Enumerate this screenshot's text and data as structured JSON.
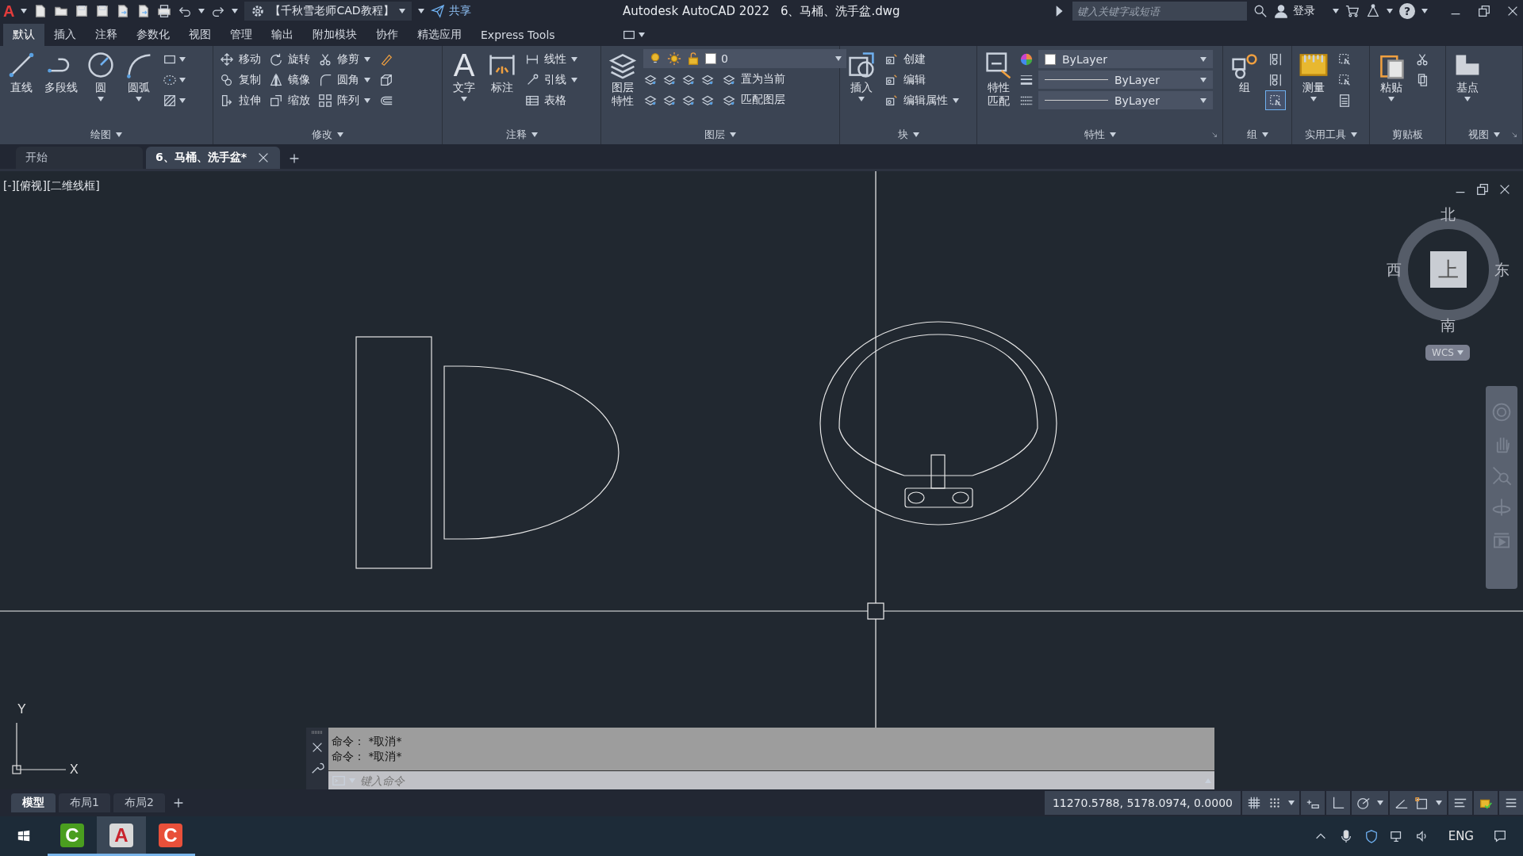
{
  "title_bar": {
    "app_glyph": "A",
    "workspace": "【千秋雪老师CAD教程】",
    "share": "共享",
    "app_title": "Autodesk AutoCAD 2022",
    "file_title": "6、马桶、洗手盆.dwg",
    "search": {
      "placeholder": "键入关键字或短语"
    },
    "user": "登录",
    "help_glyph": "?"
  },
  "ribbon": {
    "tabs": [
      {
        "label": "默认",
        "selected": true
      },
      {
        "label": "插入",
        "selected": false
      },
      {
        "label": "注释",
        "selected": false
      },
      {
        "label": "参数化",
        "selected": false
      },
      {
        "label": "视图",
        "selected": false
      },
      {
        "label": "管理",
        "selected": false
      },
      {
        "label": "输出",
        "selected": false
      },
      {
        "label": "附加模块",
        "selected": false
      },
      {
        "label": "协作",
        "selected": false
      },
      {
        "label": "精选应用",
        "selected": false
      },
      {
        "label": "Express Tools",
        "selected": false
      }
    ],
    "panels": [
      {
        "title": "绘图",
        "menu": true,
        "launcher": false,
        "columns": [
          {
            "kind": "large",
            "label": "直线",
            "dropdown": false
          },
          {
            "kind": "large",
            "label": "多段线",
            "dropdown": false
          },
          {
            "kind": "large",
            "label": "圆",
            "dropdown": true
          },
          {
            "kind": "large",
            "label": "圆弧",
            "dropdown": true
          },
          {
            "kind": "stack",
            "items": [
              {
                "kind": "icon",
                "dropdown": true
              },
              {
                "kind": "icon",
                "dropdown": true
              },
              {
                "kind": "icon",
                "dropdown": true
              }
            ]
          }
        ]
      },
      {
        "title": "修改",
        "menu": true,
        "launcher": false,
        "columns": [
          {
            "kind": "stack",
            "items": [
              {
                "kind": "small",
                "label": "移动",
                "dropdown": false
              },
              {
                "kind": "small",
                "label": "复制",
                "dropdown": false
              },
              {
                "kind": "small",
                "label": "拉伸",
                "dropdown": false
              }
            ]
          },
          {
            "kind": "stack",
            "items": [
              {
                "kind": "small",
                "label": "旋转",
                "dropdown": false
              },
              {
                "kind": "small",
                "label": "镜像",
                "dropdown": false
              },
              {
                "kind": "small",
                "label": "缩放",
                "dropdown": false
              }
            ]
          },
          {
            "kind": "stack",
            "items": [
              {
                "kind": "small",
                "label": "修剪",
                "dropdown": true
              },
              {
                "kind": "small",
                "label": "圆角",
                "dropdown": true
              },
              {
                "kind": "small",
                "label": "阵列",
                "dropdown": true
              }
            ]
          },
          {
            "kind": "stack",
            "items": [
              {
                "kind": "icon",
                "dropdown": false
              },
              {
                "kind": "icon",
                "dropdown": false
              },
              {
                "kind": "icon",
                "dropdown": false
              }
            ]
          }
        ]
      },
      {
        "title": "注释",
        "menu": true,
        "launcher": false,
        "columns": [
          {
            "kind": "large",
            "label": "文字",
            "glyph": "A",
            "dropdown": true
          },
          {
            "kind": "large",
            "label": "标注",
            "dropdown": false
          },
          {
            "kind": "stack",
            "items": [
              {
                "kind": "small",
                "label": "线性",
                "dropdown": true
              },
              {
                "kind": "small",
                "label": "引线",
                "dropdown": true
              },
              {
                "kind": "small",
                "label": "表格",
                "dropdown": false
              }
            ]
          }
        ]
      },
      {
        "title": "图层",
        "menu": true,
        "launcher": false,
        "columns": [
          {
            "kind": "large",
            "label": "图层特性",
            "dropdown": false
          },
          {
            "kind": "stack",
            "items": [
              {
                "kind": "layer_combo",
                "value": "0"
              },
              {
                "kind": "icon_row",
                "label": "置为当前"
              },
              {
                "kind": "icon_row",
                "label": "匹配图层"
              }
            ]
          }
        ]
      },
      {
        "title": "块",
        "menu": true,
        "launcher": false,
        "columns": [
          {
            "kind": "large",
            "label": "插入",
            "dropdown": true
          },
          {
            "kind": "stack",
            "items": [
              {
                "kind": "small",
                "label": "创建",
                "dropdown": false
              },
              {
                "kind": "small",
                "label": "编辑",
                "dropdown": false
              },
              {
                "kind": "small",
                "label": "编辑属性",
                "dropdown": true
              }
            ]
          }
        ]
      },
      {
        "title": "特性",
        "menu": true,
        "launcher": true,
        "columns": [
          {
            "kind": "large",
            "label": "特性匹配",
            "dropdown": false
          },
          {
            "kind": "stack",
            "items": [
              {
                "kind": "color_combo",
                "value": "ByLayer"
              },
              {
                "kind": "lineweight_combo",
                "value": "ByLayer"
              },
              {
                "kind": "linetype_combo",
                "value": "ByLayer"
              }
            ]
          }
        ]
      },
      {
        "title": "组",
        "menu": true,
        "launcher": false,
        "columns": [
          {
            "kind": "large",
            "label": "组",
            "dropdown": false
          },
          {
            "kind": "stack",
            "items": [
              {
                "kind": "icon",
                "dropdown": false,
                "on": false
              },
              {
                "kind": "icon",
                "dropdown": false,
                "on": false
              },
              {
                "kind": "icon",
                "dropdown": false,
                "on": true
              }
            ]
          }
        ]
      },
      {
        "title": "实用工具",
        "menu": true,
        "launcher": false,
        "columns": [
          {
            "kind": "large",
            "label": "测量",
            "dropdown": true
          },
          {
            "kind": "stack",
            "items": [
              {
                "kind": "icon",
                "dropdown": false
              },
              {
                "kind": "icon",
                "dropdown": false
              },
              {
                "kind": "icon",
                "dropdown": false
              }
            ]
          }
        ]
      },
      {
        "title": "剪贴板",
        "menu": false,
        "launcher": false,
        "columns": [
          {
            "kind": "large",
            "label": "粘贴",
            "dropdown": true
          },
          {
            "kind": "stack",
            "items": [
              {
                "kind": "icon",
                "dropdown": false
              },
              {
                "kind": "icon",
                "dropdown": false
              }
            ]
          }
        ]
      },
      {
        "title": "视图",
        "menu": true,
        "launcher": true,
        "columns": [
          {
            "kind": "large",
            "label": "基点",
            "dropdown": true
          }
        ]
      }
    ]
  },
  "doc_tabs": [
    {
      "label": "开始",
      "selected": false,
      "closable": false
    },
    {
      "label": "6、马桶、洗手盆*",
      "selected": true,
      "closable": true
    }
  ],
  "viewport": {
    "label": "[-][俯视][二维线框]",
    "viewcube": {
      "top": "上",
      "north": "北",
      "south": "南",
      "east": "东",
      "west": "西",
      "wcs": "WCS"
    },
    "ucs": {
      "y": "Y",
      "x": "X"
    }
  },
  "command_line": {
    "history": [
      "命令： *取消*",
      "命令： *取消*"
    ],
    "placeholder": "键入命令"
  },
  "layout_tabs": [
    {
      "label": "模型",
      "selected": true
    },
    {
      "label": "布局1",
      "selected": false
    },
    {
      "label": "布局2",
      "selected": false
    }
  ],
  "status_bar": {
    "coordinates": "11270.5788, 5178.0974, 0.0000"
  },
  "taskbar": {
    "apps": [
      {
        "glyph": "C",
        "color": "#4a9e1f",
        "selected": false
      },
      {
        "glyph": "A",
        "color": "#d8d8d8",
        "selected": true
      },
      {
        "glyph": "C",
        "color": "#e8503a",
        "selected": false
      }
    ],
    "language": "ENG"
  }
}
